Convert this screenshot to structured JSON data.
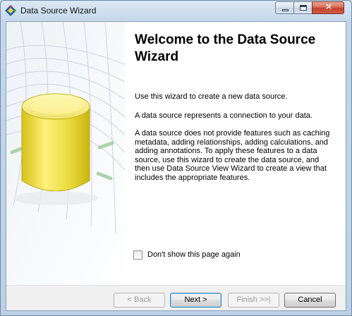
{
  "window": {
    "title": "Data Source Wizard",
    "icon": "data-source-wizard-icon",
    "controls": [
      "minimize-icon",
      "maximize-icon",
      "close-icon"
    ],
    "close_glyph": "✕"
  },
  "side_image": {
    "icon": "data-source-cylinder-illustration",
    "color": "#e6d23a"
  },
  "content": {
    "heading": "Welcome to the Data Source Wizard",
    "paragraphs": [
      "Use this wizard to create a new data source.",
      "A data source represents a connection to your data.",
      "A data source does not provide features such as caching metadata, adding relationships, adding calculations, and adding annotations. To apply these features to a data source, use this wizard to create the data source, and then use Data Source View Wizard to create a view that includes the appropriate features."
    ],
    "dont_show": {
      "label": "Don't show this page again",
      "checked": false
    }
  },
  "footer": {
    "back": "< Back",
    "next": "Next >",
    "finish": "Finish >>|",
    "cancel": "Cancel"
  },
  "colors": {
    "title_bar": "#c4d7ea",
    "close_button": "#c2422c",
    "default_button_border": "#3c7fb1"
  }
}
